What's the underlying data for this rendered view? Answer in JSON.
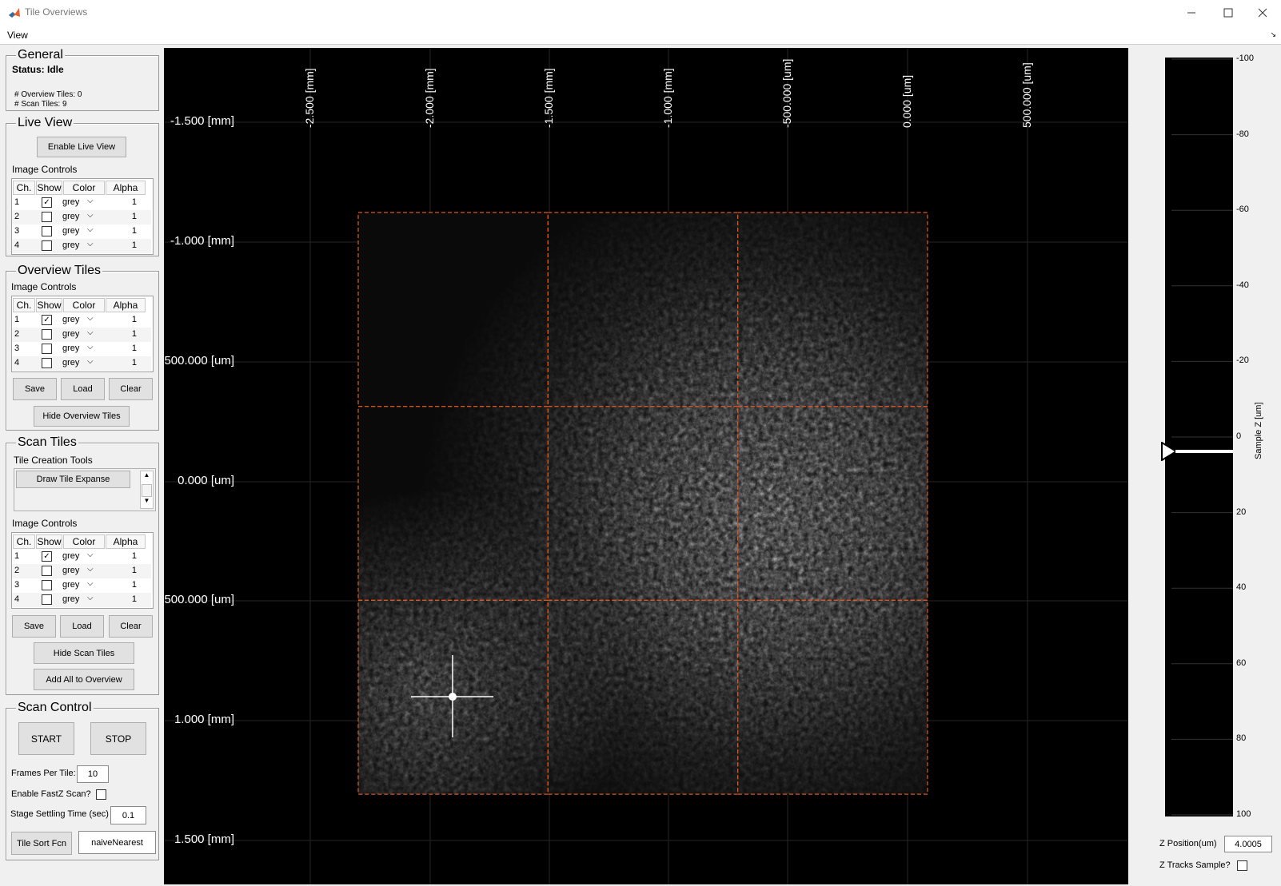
{
  "window": {
    "title": "Tile Overviews"
  },
  "menu": {
    "view": "View"
  },
  "general": {
    "title": "General",
    "status": "Status: Idle",
    "overview_tiles": "# Overview Tiles: 0",
    "scan_tiles": "# Scan Tiles: 9"
  },
  "live_view": {
    "title": "Live View",
    "enable_button": "Enable Live View",
    "image_controls_label": "Image Controls"
  },
  "table_headers": {
    "ch": "Ch.",
    "show": "Show",
    "color": "Color",
    "alpha": "Alpha"
  },
  "live_channels": [
    {
      "ch": "1",
      "show": true,
      "color": "grey",
      "alpha": "1"
    },
    {
      "ch": "2",
      "show": false,
      "color": "grey",
      "alpha": "1"
    },
    {
      "ch": "3",
      "show": false,
      "color": "grey",
      "alpha": "1"
    },
    {
      "ch": "4",
      "show": false,
      "color": "grey",
      "alpha": "1"
    }
  ],
  "overview_tiles": {
    "title": "Overview Tiles",
    "image_controls_label": "Image Controls",
    "save": "Save",
    "load": "Load",
    "clear": "Clear",
    "hide_button": "Hide Overview Tiles"
  },
  "overview_channels": [
    {
      "ch": "1",
      "show": true,
      "color": "grey",
      "alpha": "1"
    },
    {
      "ch": "2",
      "show": false,
      "color": "grey",
      "alpha": "1"
    },
    {
      "ch": "3",
      "show": false,
      "color": "grey",
      "alpha": "1"
    },
    {
      "ch": "4",
      "show": false,
      "color": "grey",
      "alpha": "1"
    }
  ],
  "scan_tiles": {
    "title": "Scan Tiles",
    "tools_label": "Tile Creation Tools",
    "draw_button": "Draw Tile Expanse",
    "image_controls_label": "Image Controls",
    "save": "Save",
    "load": "Load",
    "clear": "Clear",
    "hide_button": "Hide Scan Tiles",
    "add_button": "Add All to Overview"
  },
  "scan_channels": [
    {
      "ch": "1",
      "show": true,
      "color": "grey",
      "alpha": "1"
    },
    {
      "ch": "2",
      "show": false,
      "color": "grey",
      "alpha": "1"
    },
    {
      "ch": "3",
      "show": false,
      "color": "grey",
      "alpha": "1"
    },
    {
      "ch": "4",
      "show": false,
      "color": "grey",
      "alpha": "1"
    }
  ],
  "scan_control": {
    "title": "Scan Control",
    "start": "START",
    "stop": "STOP",
    "frames_label": "Frames Per Tile:",
    "frames_value": "10",
    "fastz_label": "Enable FastZ Scan?",
    "fastz_checked": false,
    "settle_label": "Stage Settling Time (sec)",
    "settle_value": "0.1",
    "sort_button": "Tile Sort Fcn",
    "sort_value": "naiveNearest"
  },
  "viewer": {
    "x_ticks": [
      "-2.500 [mm]",
      "-2.000 [mm]",
      "-1.500 [mm]",
      "-1.000 [mm]",
      "-500.000 [um]",
      "0.000 [um]",
      "500.000 [um]"
    ],
    "y_ticks": [
      "-1.500 [mm]",
      "-1.000 [mm]",
      "500.000 [um]",
      "0.000 [um]",
      "500.000 [um]",
      "1.000 [mm]",
      "1.500 [mm]"
    ],
    "tile_grid": {
      "rows": 3,
      "cols": 3
    },
    "tile_outline_color": "#e0561f"
  },
  "z_panel": {
    "axis_label": "Sample Z [um]",
    "ticks": [
      "-100",
      "-80",
      "-60",
      "-40",
      "-20",
      "0",
      "20",
      "40",
      "60",
      "80",
      "100"
    ],
    "current_z": 0,
    "z_position_label": "Z Position(um)",
    "z_position_value": "4.0005",
    "z_tracks_label": "Z Tracks Sample?",
    "z_tracks_checked": false
  }
}
